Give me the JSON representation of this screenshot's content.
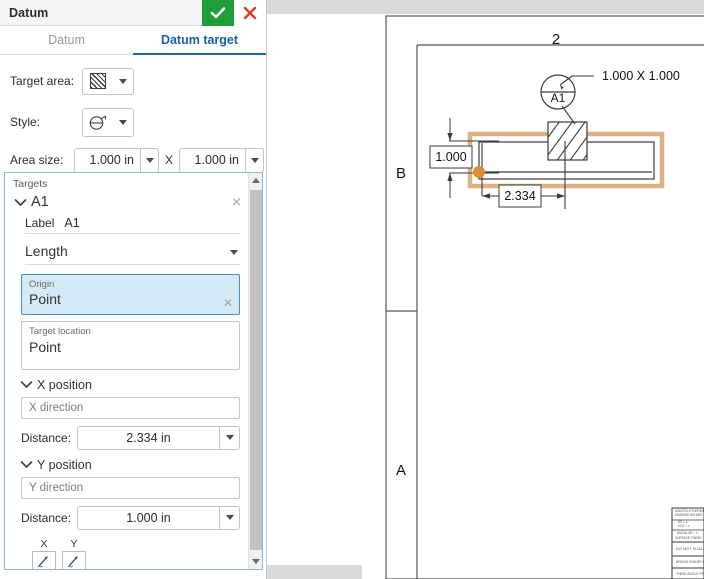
{
  "panel": {
    "title": "Datum",
    "accept_icon": "check-icon",
    "cancel_icon": "close-icon",
    "accept_color": "#1e9e36",
    "cancel_color": "#e03a22",
    "tabs": [
      {
        "label": "Datum",
        "active": false
      },
      {
        "label": "Datum target",
        "active": true
      }
    ],
    "active_tab_color": "#1461a8",
    "fields": {
      "target_area_label": "Target area:",
      "target_area_icon": "hatched-square-icon",
      "style_label": "Style:",
      "style_icon": "datum-target-circle-icon",
      "area_size_label": "Area size:",
      "area_size_width": "1.000 in",
      "area_size_separator": "X",
      "area_size_height": "1.000 in"
    }
  },
  "targets": {
    "caption": "Targets",
    "group": {
      "name": "A1",
      "expanded": true,
      "close_icon": "close-small-icon",
      "label_key": "Label",
      "label_value": "A1",
      "type_select": "Length",
      "origin": {
        "caption": "Origin",
        "value": "Point",
        "selected": true,
        "clear_icon": "clear-icon"
      },
      "target_location": {
        "caption": "Target location",
        "value": "Point"
      },
      "x_position": {
        "section_title": "X position",
        "direction_placeholder": "X direction",
        "distance_label": "Distance:",
        "distance_value": "2.334 in"
      },
      "y_position": {
        "section_title": "Y position",
        "direction_placeholder": "Y direction",
        "distance_label": "Distance:",
        "distance_value": "1.000 in"
      },
      "flip": {
        "x_caption": "X",
        "y_caption": "Y",
        "x_icon": "flip-direction-x-icon",
        "y_icon": "flip-direction-y-icon"
      }
    }
  },
  "drawing": {
    "sheet_zone_top": "2",
    "sheet_zone_left_upper": "B",
    "sheet_zone_left_lower": "A",
    "datum_target_label": "A1",
    "datum_target_note": "1.000 X 1.000",
    "dimension_vertical": "1.000",
    "dimension_horizontal": "2.334",
    "highlight_color": "#dcb284",
    "origin_dot_color": "#dd8e33",
    "line_color": "#3a3a3a",
    "title_block_lines": [
      "UNLESS OTHERWISE SPECIFIED",
      "DIMENSIONS ARE IN INCHES",
      ".XX = ±",
      ".XXX = ±",
      "ANGULAR = ±",
      "SURFACE FINISH",
      "DO NOT SCALE DRAWING",
      "BREAK SHARP EDGES",
      "THIRD ANGLE PROJECTION"
    ]
  }
}
